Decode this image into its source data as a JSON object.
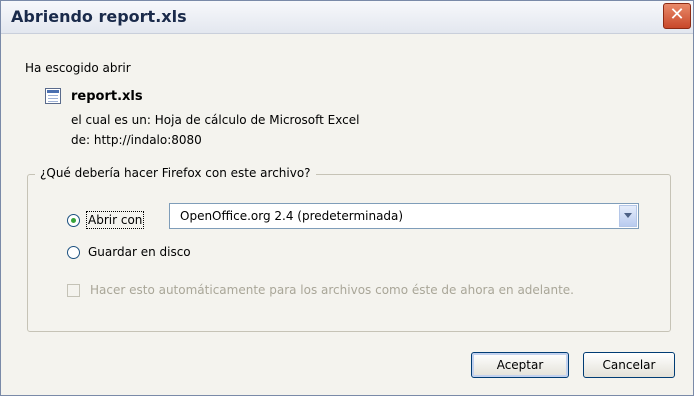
{
  "window": {
    "title": "Abriendo report.xls",
    "close_glyph": "✕"
  },
  "dialog": {
    "intro": "Ha escogido abrir",
    "filename": "report.xls",
    "file_icon": "spreadsheet-file-icon",
    "type_label": "el cual es un:",
    "type_value": "Hoja de cálculo de Microsoft Excel",
    "from_label": "de:",
    "from_value": "http://indalo:8080"
  },
  "action": {
    "legend": "¿Qué debería hacer Firefox con este archivo?",
    "open_with_label": "Abrir con",
    "open_with_selected": true,
    "application": "OpenOffice.org 2.4 (predeterminada)",
    "save_label": "Guardar en disco",
    "save_selected": false,
    "auto_label": "Hacer esto automáticamente para los archivos como éste de ahora en adelante.",
    "auto_checked": false,
    "auto_enabled": false
  },
  "buttons": {
    "accept": "Aceptar",
    "cancel": "Cancelar"
  }
}
